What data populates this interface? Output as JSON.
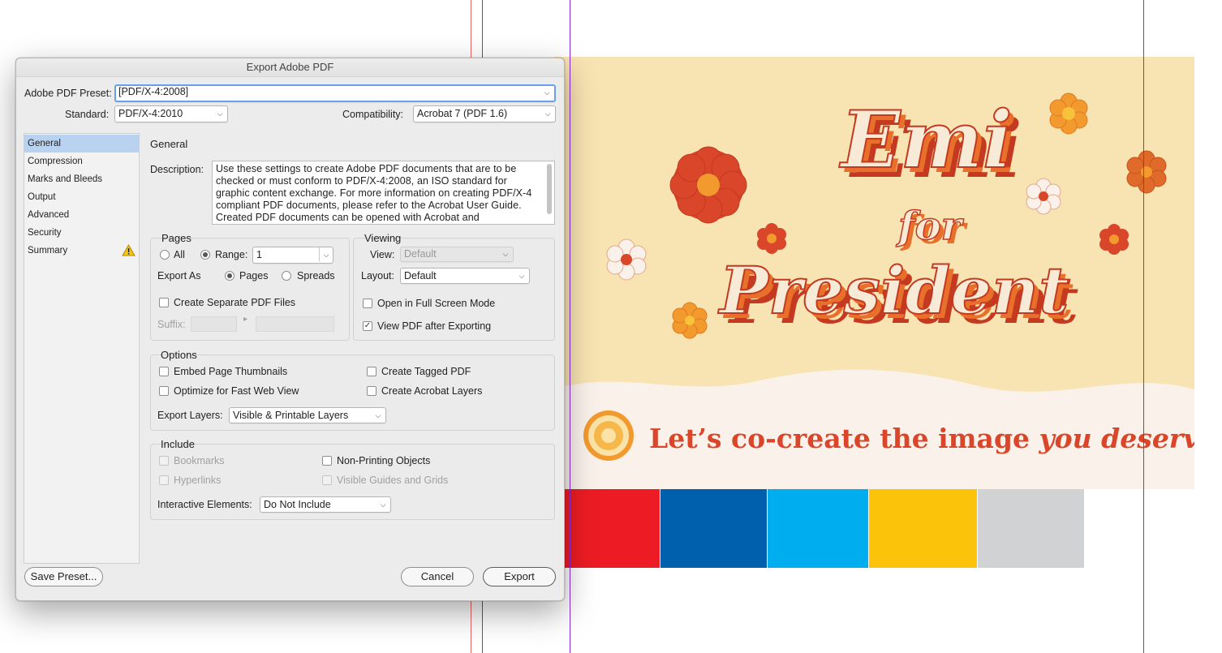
{
  "dialog": {
    "title": "Export Adobe PDF",
    "preset_label": "Adobe PDF Preset:",
    "preset_value": "[PDF/X-4:2008]",
    "standard_label": "Standard:",
    "standard_value": "PDF/X-4:2010",
    "compat_label": "Compatibility:",
    "compat_value": "Acrobat 7 (PDF 1.6)"
  },
  "sidebar": {
    "items": [
      {
        "label": "General",
        "selected": true
      },
      {
        "label": "Compression"
      },
      {
        "label": "Marks and Bleeds"
      },
      {
        "label": "Output"
      },
      {
        "label": "Advanced"
      },
      {
        "label": "Security"
      },
      {
        "label": "Summary",
        "warning": true
      }
    ]
  },
  "general": {
    "heading": "General",
    "description_label": "Description:",
    "description": "Use these settings to create Adobe PDF documents that are to be checked or must conform to PDF/X-4:2008, an ISO standard for graphic content exchange.  For more information on creating PDF/X-4 compliant PDF documents, please refer to the Acrobat User Guide.  Created PDF documents can be opened with Acrobat and"
  },
  "pages": {
    "title": "Pages",
    "all_label": "All",
    "range_label": "Range:",
    "range_value": "1",
    "export_as_label": "Export As",
    "pages_label": "Pages",
    "spreads_label": "Spreads",
    "separate_label": "Create Separate PDF Files",
    "suffix_label": "Suffix:"
  },
  "viewing": {
    "title": "Viewing",
    "view_label": "View:",
    "view_value": "Default",
    "layout_label": "Layout:",
    "layout_value": "Default",
    "fullscreen_label": "Open in Full Screen Mode",
    "viewpdf_label": "View PDF after Exporting"
  },
  "options": {
    "title": "Options",
    "thumbs_label": "Embed Page Thumbnails",
    "tagged_label": "Create Tagged PDF",
    "fastweb_label": "Optimize for Fast Web View",
    "acrolayers_label": "Create Acrobat Layers",
    "export_layers_label": "Export Layers:",
    "export_layers_value": "Visible & Printable Layers"
  },
  "include": {
    "title": "Include",
    "bookmarks_label": "Bookmarks",
    "nonprinting_label": "Non-Printing Objects",
    "hyperlinks_label": "Hyperlinks",
    "guides_label": "Visible Guides and Grids",
    "interactive_label": "Interactive Elements:",
    "interactive_value": "Do Not Include"
  },
  "buttons": {
    "save_preset": "Save Preset...",
    "cancel": "Cancel",
    "export": "Export"
  },
  "artwork": {
    "line1": "Emi",
    "line2": "for",
    "line3": "President",
    "tagline_a": "Let’s co-create the image ",
    "tagline_b": "you deserve"
  },
  "colors": {
    "swatches": [
      "#ed1c24",
      "#0060ad",
      "#00aeef",
      "#fcc30b",
      "#d1d2d4"
    ],
    "cream": "#f8e4b2",
    "orange": "#e8702a",
    "red_orange": "#d9462a"
  }
}
